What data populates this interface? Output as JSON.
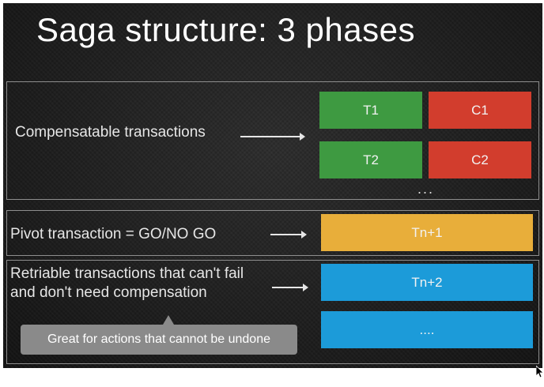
{
  "slide": {
    "title": "Saga structure: 3 phases"
  },
  "compensatable": {
    "label": "Compensatable transactions",
    "boxes": [
      {
        "label": "T1",
        "color": "#3e9a41"
      },
      {
        "label": "C1",
        "color": "#d23d2d"
      },
      {
        "label": "T2",
        "color": "#3e9a41"
      },
      {
        "label": "C2",
        "color": "#d23d2d"
      }
    ],
    "ellipsis": "..."
  },
  "pivot": {
    "label": "Pivot transaction = GO/NO GO",
    "box": {
      "label": "Tn+1",
      "color": "#e8ae3a"
    }
  },
  "retriable": {
    "label_line1": "Retriable transactions that can't fail",
    "label_line2": "and don't need compensation",
    "boxes": [
      {
        "label": "Tn+2",
        "color": "#1c9bd9"
      },
      {
        "label": "....",
        "color": "#1c9bd9"
      }
    ]
  },
  "tooltip": {
    "text": "Great for actions that cannot be undone"
  }
}
